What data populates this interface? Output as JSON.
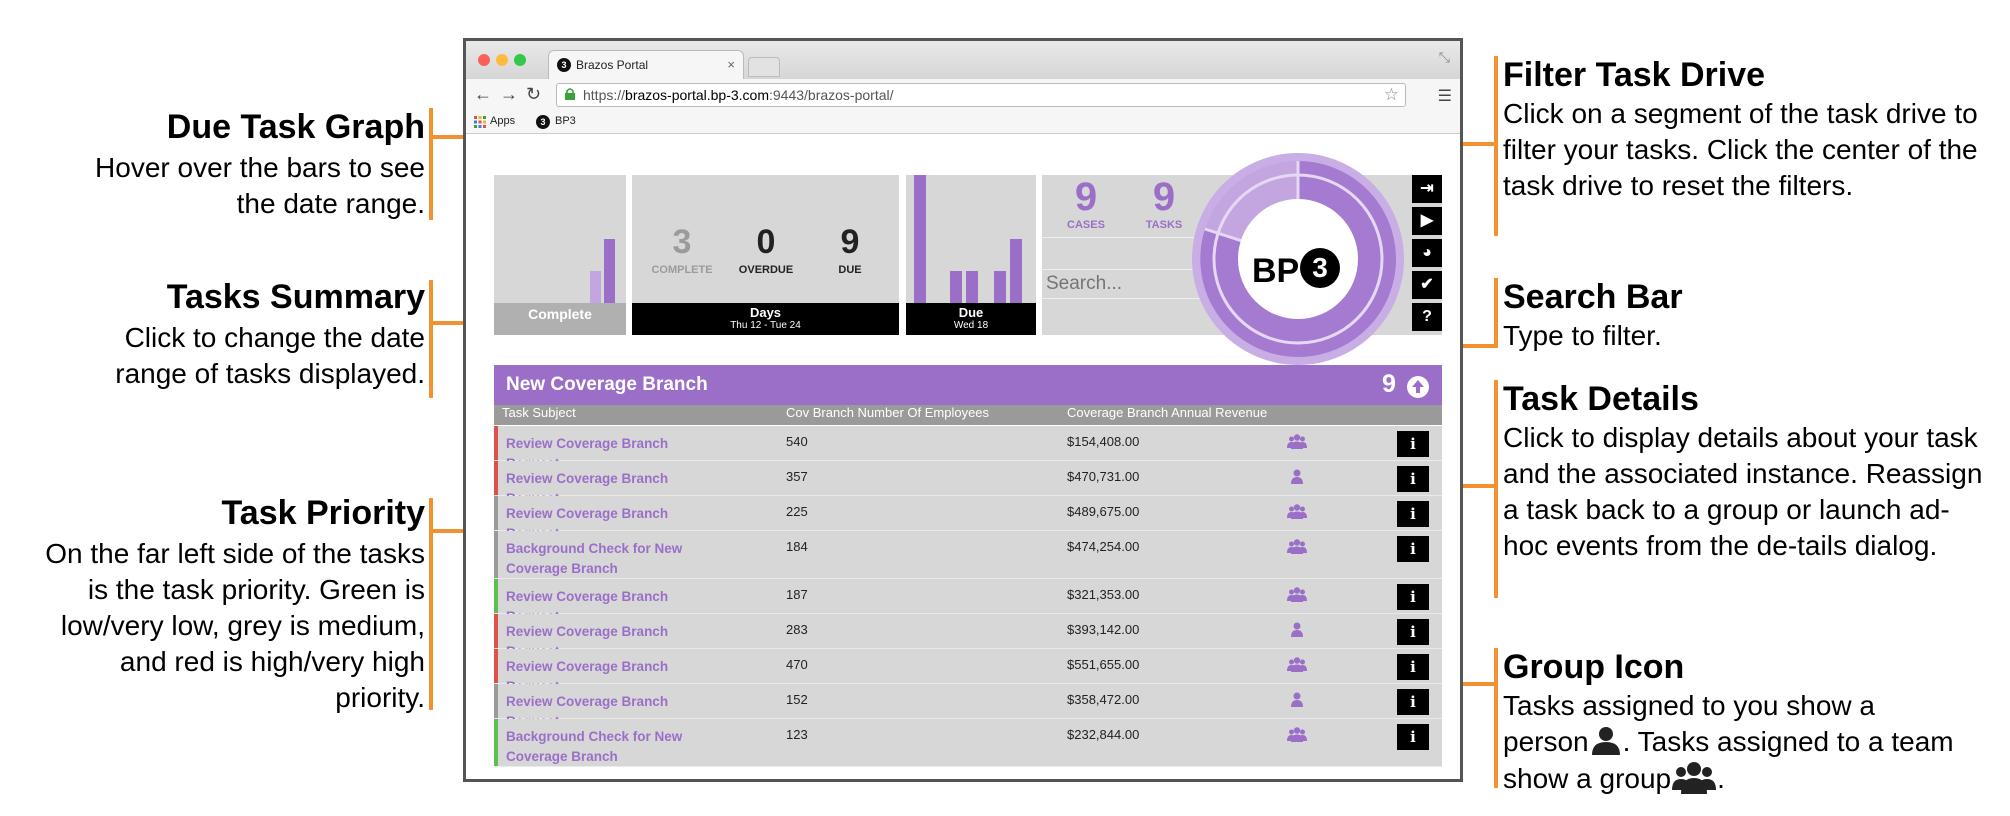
{
  "annotations": {
    "due_task_graph": {
      "title": "Due Task Graph",
      "desc": "Hover over the bars to see the date range."
    },
    "tasks_summary": {
      "title": "Tasks Summary",
      "desc": "Click to change the date range of tasks displayed."
    },
    "task_priority": {
      "title": "Task Priority",
      "desc": "On the far left side of the tasks is the task priority. Green is low/very low, grey is medium, and red is high/very high priority."
    },
    "filter_task_drive": {
      "title": "Filter Task Drive",
      "desc": "Click on a segment of the task drive to filter your tasks. Click the center of the task drive to reset the filters."
    },
    "search_bar": {
      "title": "Search Bar",
      "desc": "Type to filter."
    },
    "task_details": {
      "title": "Task Details",
      "desc": "Click to display details about your task and the associated instance. Reassign a task back to a group or launch ad-hoc events from the de-tails dialog."
    },
    "group_icon": {
      "title": "Group Icon",
      "desc_1": "Tasks assigned to you show a person",
      "desc_2": ". Tasks assigned to a team show a group",
      "desc_3": "."
    }
  },
  "browser": {
    "tab_title": "Brazos Portal",
    "tab_close": "×",
    "favicon": "3",
    "url_prefix": "https://",
    "url_host": "brazos-portal.bp-3.com",
    "url_rest": ":9443/brazos-portal/",
    "bookmarks": [
      "Apps",
      "BP3"
    ],
    "nav_icons": [
      "back-icon",
      "forward-icon",
      "reload-icon"
    ],
    "colors": {
      "close": "#fc605b",
      "minimize": "#fdbc40",
      "zoom": "#34c84a"
    }
  },
  "dashboard": {
    "complete": {
      "label": "Complete"
    },
    "summary": {
      "complete_count": "3",
      "complete_label": "COMPLETE",
      "overdue_count": "0",
      "overdue_label": "OVERDUE",
      "due_count": "9",
      "due_label": "DUE",
      "footer_title": "Days",
      "footer_sub": "Thu 12 - Tue 24"
    },
    "due": {
      "title": "Due",
      "sub": "Wed 18"
    },
    "cases": {
      "value": "9",
      "label": "CASES"
    },
    "tasks": {
      "value": "9",
      "label": "TASKS"
    },
    "search_placeholder": "Search...",
    "logo_text": "BP",
    "logo_badge": "3",
    "side_buttons": [
      "sign-out-icon",
      "play-icon",
      "dashboard-icon",
      "check-icon",
      "help-icon"
    ],
    "side_glyphs": [
      "⇥",
      "▶",
      "◕",
      "✔",
      "?"
    ]
  },
  "table": {
    "title": "New Coverage Branch",
    "count": "9",
    "columns": [
      "Task Subject",
      "Cov Branch Number Of Employees",
      "Coverage Branch Annual Revenue"
    ],
    "info_label": "i",
    "rows": [
      {
        "subject": "Review Coverage Branch Request",
        "employees": "540",
        "revenue": "$154,408.00",
        "priority": "red",
        "assignee": "group"
      },
      {
        "subject": "Review Coverage Branch Request",
        "employees": "357",
        "revenue": "$470,731.00",
        "priority": "red",
        "assignee": "person"
      },
      {
        "subject": "Review Coverage Branch Request",
        "employees": "225",
        "revenue": "$489,675.00",
        "priority": "grey",
        "assignee": "group"
      },
      {
        "subject": "Background Check for New Coverage Branch",
        "employees": "184",
        "revenue": "$474,254.00",
        "priority": "grey",
        "assignee": "group"
      },
      {
        "subject": "Review Coverage Branch Request",
        "employees": "187",
        "revenue": "$321,353.00",
        "priority": "green",
        "assignee": "group"
      },
      {
        "subject": "Review Coverage Branch Request",
        "employees": "283",
        "revenue": "$393,142.00",
        "priority": "red",
        "assignee": "person"
      },
      {
        "subject": "Review Coverage Branch Request",
        "employees": "470",
        "revenue": "$551,655.00",
        "priority": "red",
        "assignee": "group"
      },
      {
        "subject": "Review Coverage Branch Request",
        "employees": "152",
        "revenue": "$358,472.00",
        "priority": "grey",
        "assignee": "person"
      },
      {
        "subject": "Background Check for New Coverage Branch",
        "employees": "123",
        "revenue": "$232,844.00",
        "priority": "green",
        "assignee": "group"
      }
    ]
  },
  "colors": {
    "accent": "#9b6fc8",
    "accent_light": "#c3a6e0",
    "annotation": "#f39130",
    "panel": "#d7d7d7",
    "priority_red": "#e0504a",
    "priority_grey": "#9a9a9a",
    "priority_green": "#5cbf4e"
  }
}
